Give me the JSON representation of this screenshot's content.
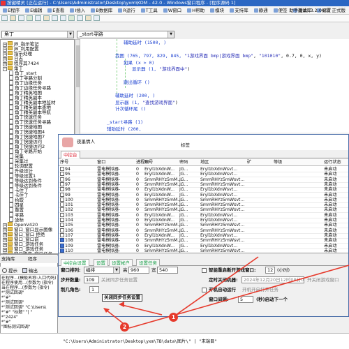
{
  "window": {
    "title": "按键精灵 [正在运行] - C:\\Users\\Administrator\\Desktop\\yxm\\KOM - 42.0 - Windows窗口程序 - [程序源码 1]"
  },
  "menubar": {
    "items": [
      "E程序",
      "E编辑",
      "E查看",
      "I插入",
      "B数据库",
      "R运行",
      "T工具",
      "W窗口",
      "H帮助",
      "模块",
      "支持库",
      "静通",
      "便签",
      "调试库",
      "设置"
    ],
    "version_label": "助手版本:",
    "version": "3.2.0407 正式版"
  },
  "selectors": {
    "left_combo": "角丁",
    "right_combo": "_start寻路"
  },
  "tree": {
    "nodes": [
      {
        "label": "JB_指示笔记",
        "level": 1,
        "kind": "folder",
        "exp": "+"
      },
      {
        "label": "JB_利用配置",
        "level": 1,
        "kind": "folder",
        "exp": "+"
      },
      {
        "label": "指示处理",
        "level": 1,
        "kind": "folder",
        "exp": "+"
      },
      {
        "label": "日志",
        "level": 1,
        "kind": "folder",
        "exp": "+"
      },
      {
        "label": "程序其7424",
        "level": 1,
        "kind": "folder",
        "exp": "+"
      },
      {
        "label": "角丁",
        "level": 1,
        "kind": "folder",
        "exp": "-"
      },
      {
        "label": "角丁_start",
        "level": 2,
        "kind": "doc"
      },
      {
        "label": "角丁寻路分割",
        "level": 2,
        "kind": "doc"
      },
      {
        "label": "角丁边缘任务",
        "level": 2,
        "kind": "doc"
      },
      {
        "label": "角丁边缘任务寻路",
        "level": 2,
        "kind": "doc"
      },
      {
        "label": "角丁精英地图",
        "level": 2,
        "kind": "doc"
      },
      {
        "label": "角丁精英副本",
        "level": 2,
        "kind": "doc"
      },
      {
        "label": "角丁精英副本地监材",
        "level": 2,
        "kind": "doc"
      },
      {
        "label": "角丁精英副本查地",
        "level": 2,
        "kind": "doc"
      },
      {
        "label": "角丁精英副本导航",
        "level": 2,
        "kind": "doc"
      },
      {
        "label": "角丁快速任务",
        "level": 2,
        "kind": "doc"
      },
      {
        "label": "角丁快速任务寻路",
        "level": 2,
        "kind": "doc"
      },
      {
        "label": "角丁快捷地图",
        "level": 2,
        "kind": "doc"
      },
      {
        "label": "角丁快捷地图4",
        "level": 2,
        "kind": "doc"
      },
      {
        "label": "角丁快捷地图7",
        "level": 2,
        "kind": "doc"
      },
      {
        "label": "角丁快捷访问",
        "level": 2,
        "kind": "doc"
      },
      {
        "label": "角丁快捷访问2",
        "level": 2,
        "kind": "doc"
      },
      {
        "label": "角丁寻路开始",
        "level": 2,
        "kind": "doc"
      },
      {
        "label": "采集",
        "level": 2,
        "kind": "doc"
      },
      {
        "label": "采集过",
        "level": 2,
        "kind": "doc"
      },
      {
        "label": "轮询配置",
        "level": 2,
        "kind": "doc"
      },
      {
        "label": "升级设计",
        "level": 2,
        "kind": "doc"
      },
      {
        "label": "等级设置1",
        "level": 2,
        "kind": "doc"
      },
      {
        "label": "等级达到条件",
        "level": 2,
        "kind": "doc"
      },
      {
        "label": "等级达到条件",
        "level": 2,
        "kind": "doc"
      },
      {
        "label": "卡住了",
        "level": 2,
        "kind": "doc"
      },
      {
        "label": "卡住了",
        "level": 2,
        "kind": "doc"
      },
      {
        "label": "拾取",
        "level": 2,
        "kind": "doc"
      },
      {
        "label": "四星",
        "level": 2,
        "kind": "doc"
      },
      {
        "label": "重置",
        "level": 2,
        "kind": "doc"
      },
      {
        "label": "寻路",
        "level": 2,
        "kind": "doc"
      },
      {
        "label": "坐标",
        "level": 2,
        "kind": "doc"
      },
      {
        "label": "OpenV420",
        "level": 1,
        "kind": "folder",
        "exp": "+"
      },
      {
        "label": "窗口_窗口显示图像",
        "level": 1,
        "kind": "folder",
        "exp": "+"
      },
      {
        "label": "窗口_窗口 拒绝",
        "level": 1,
        "kind": "folder",
        "exp": "+"
      },
      {
        "label": "窗口_窗口前",
        "level": 1,
        "kind": "folder",
        "exp": "+"
      },
      {
        "label": "窗口_游戏任务",
        "level": 1,
        "kind": "folder",
        "exp": "+"
      },
      {
        "label": "窗口_游戏任务",
        "level": 1,
        "kind": "folder",
        "exp": "+"
      },
      {
        "label": "窗口程序_窗口任务",
        "level": 1,
        "kind": "folder",
        "exp": "+"
      }
    ]
  },
  "code": {
    "lines": [
      {
        "indent": 0,
        "parts": [
          {
            "t": "辅助延时 (1500, )",
            "c": "fn"
          }
        ]
      },
      {
        "indent": 0,
        "parts": []
      },
      {
        "indent": -1,
        "parts": [
          {
            "t": "找图 (765, 797, 829, 845, ",
            "c": "fn"
          },
          {
            "t": "\"1游戏界面 bmp|游戏界面 bmp\"",
            "c": "st"
          },
          {
            "t": ", ",
            "c": "nm"
          },
          {
            "t": "\"101010\"",
            "c": "st"
          },
          {
            "t": ", 0.7, 0, x, y)",
            "c": "nm"
          }
        ]
      },
      {
        "indent": 0,
        "parts": [
          {
            "t": "如果 (x > 0)",
            "c": "fn"
          }
        ]
      },
      {
        "indent": 1,
        "parts": [
          {
            "t": "显示器 (1, ",
            "c": "fn"
          },
          {
            "t": "\"游戏界面中\"",
            "c": "st"
          },
          {
            "t": ")",
            "c": "nm"
          }
        ]
      },
      {
        "indent": 0,
        "parts": []
      },
      {
        "indent": 0,
        "parts": [
          {
            "t": "跳出循环 ()",
            "c": "fn"
          }
        ]
      },
      {
        "indent": 0,
        "parts": []
      },
      {
        "indent": -1,
        "parts": [
          {
            "t": "辅助延时 (200, )",
            "c": "fn"
          }
        ]
      },
      {
        "indent": -1,
        "parts": [
          {
            "t": "显示器 (1, ",
            "c": "fn"
          },
          {
            "t": "\"查找游戏界面\"",
            "c": "st"
          },
          {
            "t": ")",
            "c": "nm"
          }
        ]
      },
      {
        "indent": -1,
        "parts": [
          {
            "t": "计次循环尾 ()",
            "c": "fn"
          }
        ]
      },
      {
        "indent": -1,
        "parts": []
      },
      {
        "indent": -2,
        "parts": [
          {
            "t": "_start寻路 (1)",
            "c": "fn"
          }
        ]
      },
      {
        "indent": -2,
        "parts": [
          {
            "t": "辅助延时 (200,",
            "c": "fn"
          }
        ]
      }
    ]
  },
  "dialog": {
    "title": "夜墨情人",
    "tag_label": "标签",
    "tabs_top": [
      "中控台"
    ],
    "columns": [
      "序号",
      "窗口",
      "进程ID",
      "账号",
      "密码",
      "地区",
      "矿",
      "等级",
      "运行状态"
    ],
    "rows": [
      {
        "check": false,
        "idx": "94",
        "win": "雷电模拟器-",
        "pid": "0",
        "acc": "Eryl1bXdnW...",
        "pwd": "JG...",
        "region": "Eryl1bXdnWsvt...",
        "ore": "",
        "lvl": "",
        "status": "未启动"
      },
      {
        "check": false,
        "idx": "95",
        "win": "雷电模拟器-",
        "pid": "0",
        "acc": "Eryl1bXdnW...",
        "pwd": "JG...",
        "region": "Eryl1bXdnWsvt...",
        "ore": "",
        "lvl": "",
        "status": "未启动"
      },
      {
        "check": false,
        "idx": "96",
        "win": "雷电模拟器-",
        "pid": "0",
        "acc": "SmmRHYz5mM...",
        "pwd": "JG...",
        "region": "SmmRHYz5mWsvt...",
        "ore": "",
        "lvl": "",
        "status": "未启动"
      },
      {
        "check": false,
        "idx": "97",
        "win": "雷电模拟器-",
        "pid": "0",
        "acc": "SmmRHYz5mM...",
        "pwd": "JG...",
        "region": "SmmRHYz5mWsvt...",
        "ore": "",
        "lvl": "",
        "status": "未启动"
      },
      {
        "check": false,
        "idx": "98",
        "win": "雷电模拟器-",
        "pid": "0",
        "acc": "Eryl1bXdnW...",
        "pwd": "JG...",
        "region": "Eryl1bXdnWsvt...",
        "ore": "",
        "lvl": "",
        "status": "未启动"
      },
      {
        "check": false,
        "idx": "99",
        "win": "雷电模拟器-",
        "pid": "0",
        "acc": "Eryl1bXdnW...",
        "pwd": "JG...",
        "region": "Eryl1bXdnWsvt...",
        "ore": "",
        "lvl": "",
        "status": "未启动"
      },
      {
        "check": false,
        "idx": "100",
        "win": "雷电模拟器-",
        "pid": "0",
        "acc": "SmmRHYz5mM...",
        "pwd": "JG...",
        "region": "SmmRHYz5mWsvt...",
        "ore": "",
        "lvl": "",
        "status": "未启动"
      },
      {
        "check": false,
        "idx": "101",
        "win": "雷电模拟器-",
        "pid": "0",
        "acc": "SmmRHYz5mM...",
        "pwd": "JG...",
        "region": "SmmRHYz5mWsvt...",
        "ore": "",
        "lvl": "",
        "status": "未启动"
      },
      {
        "check": false,
        "idx": "102",
        "win": "雷电模拟器-",
        "pid": "0",
        "acc": "SmmRHYz5mM...",
        "pwd": "JG...",
        "region": "SmmRHYz5mWsvt...",
        "ore": "",
        "lvl": "",
        "status": "未启动"
      },
      {
        "check": false,
        "idx": "103",
        "win": "雷电模拟器-",
        "pid": "0",
        "acc": "Eryl1bXdnW...",
        "pwd": "JG...",
        "region": "Eryl1bXdnWsvt...",
        "ore": "",
        "lvl": "",
        "status": "未启动"
      },
      {
        "check": false,
        "idx": "104",
        "win": "雷电模拟器-",
        "pid": "0",
        "acc": "Eryl1bXdnW...",
        "pwd": "JG...",
        "region": "Eryl1bXdnWsvt...",
        "ore": "",
        "lvl": "",
        "status": "未启动"
      },
      {
        "check": false,
        "idx": "105",
        "win": "雷电模拟器-",
        "pid": "0",
        "acc": "SmmRHYz5mM...",
        "pwd": "JG...",
        "region": "SmmRHYz5mWsvt...",
        "ore": "",
        "lvl": "",
        "status": "未启动"
      },
      {
        "check": false,
        "idx": "106",
        "win": "雷电模拟器-",
        "pid": "0",
        "acc": "SmmRHYz5mM...",
        "pwd": "JG...",
        "region": "SmmRHYz5mWsvt...",
        "ore": "",
        "lvl": "",
        "status": "未启动"
      },
      {
        "check": false,
        "idx": "107",
        "win": "雷电模拟器-",
        "pid": "0",
        "acc": "Eryl1bXdnW...",
        "pwd": "JG...",
        "region": "Eryl1bXdnWsvt...",
        "ore": "",
        "lvl": "",
        "status": "未启动"
      },
      {
        "check": true,
        "idx": "108",
        "win": "雷电模拟器-",
        "pid": "0",
        "acc": "SmmRHYz5mM...",
        "pwd": "JG...",
        "region": "SmmRHYz5mWsvt...",
        "ore": "",
        "lvl": "",
        "status": "未启动"
      },
      {
        "check": true,
        "idx": "109",
        "win": "雷电模拟器-",
        "pid": "0",
        "acc": "Eryl1bXdnW...",
        "pwd": "JG...",
        "region": "Eryl1bXdnWsvt...",
        "ore": "",
        "lvl": "",
        "status": "未启动"
      },
      {
        "check": true,
        "idx": "110",
        "win": "雷电模拟器-",
        "pid": "0",
        "acc": "SmmRHYz5mM...",
        "pwd": "JG...",
        "region": "SmmRHYz5mWsvt...",
        "ore": "",
        "lvl": "",
        "status": "未启动"
      }
    ],
    "tabs_bottom": [
      "中控台设置",
      "设置",
      "设置帐户",
      "设置任务"
    ],
    "settings": {
      "sort_label": "窗口排列:",
      "sort_value": "编排",
      "width_label": "高",
      "width_value": "960",
      "height_label": "宽",
      "height_value": "540",
      "step_label": "步开数量:",
      "step_value": "109",
      "step_hint": "关闭同步任务设置",
      "angle_label": "制几角色:",
      "angle_value": "1",
      "angle_hint": "",
      "tooltip": "关闭同步任务设置",
      "restart_label": "智能重启断开游戏窗口:",
      "restart_value": "12",
      "restart_unit": "(小时)",
      "timer_label": "定时关闭机器:",
      "timer_value": "2024年12月20日12时08分09秒",
      "timer_tail": "开关闭游戏窗口",
      "autorun_label": "开机自动运行",
      "autorun_hint": "开机开启打开任务",
      "window_label": "窗口间隔:",
      "window_value": "5",
      "window_unit": "(秒)启动下一个"
    }
  },
  "output": {
    "tabs": [
      "支持库",
      "程序"
    ],
    "tools": [
      "提示",
      "输出"
    ],
    "lines": [
      "在程序...(模板名称:入口代码)",
      "在程序使用...(参数为 (指令)",
      "当在程序...(参数为 (指令)",
      "*\"测试回调\"",
      "*\"#\"",
      "*\"测试回调\"",
      "*\"测试回调\" \"C:\\Users\\",
      "*\"#\" \"标题\" \"| \"",
      "*\"2424\"",
      "*\"#\" ",
      "\"图标测试回调\""
    ],
    "bottom_code": "\"C:\\Users\\Administrator\\Desktop\\yxm\\TB\\data\\图片\\\" | \"末端目\""
  },
  "annotations": {
    "badge1": "1",
    "badge2": "2"
  },
  "colors": {
    "title_bar": "#2b67c3",
    "arrow": "#e63a2c",
    "tab_red": "#d23",
    "tab_green": "#1aa04a"
  }
}
